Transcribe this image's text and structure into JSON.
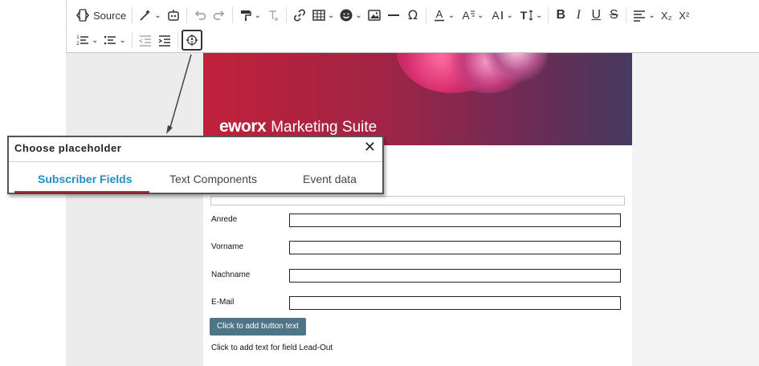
{
  "toolbar": {
    "source_label": "Source",
    "subscript_label": "X₂",
    "superscript_label": "X²"
  },
  "banner": {
    "logo_text": "eworx",
    "suite_text": "Marketing Suite"
  },
  "form": {
    "fields": [
      {
        "label": "Anrede"
      },
      {
        "label": "Vorname"
      },
      {
        "label": "Nachname"
      },
      {
        "label": "E-Mail"
      }
    ],
    "button_text": "Click to add button text",
    "leadout_text": "Click to add text for field Lead-Out"
  },
  "popup": {
    "title": "Choose placeholder",
    "close": "✕",
    "tabs": [
      {
        "label": "Subscriber Fields",
        "active": true
      },
      {
        "label": "Text Components",
        "active": false
      },
      {
        "label": "Event data",
        "active": false
      }
    ]
  },
  "colors": {
    "active_tab": "#1f8fc2",
    "tab_underline": "#c62437",
    "cta_button": "#4e7585"
  }
}
